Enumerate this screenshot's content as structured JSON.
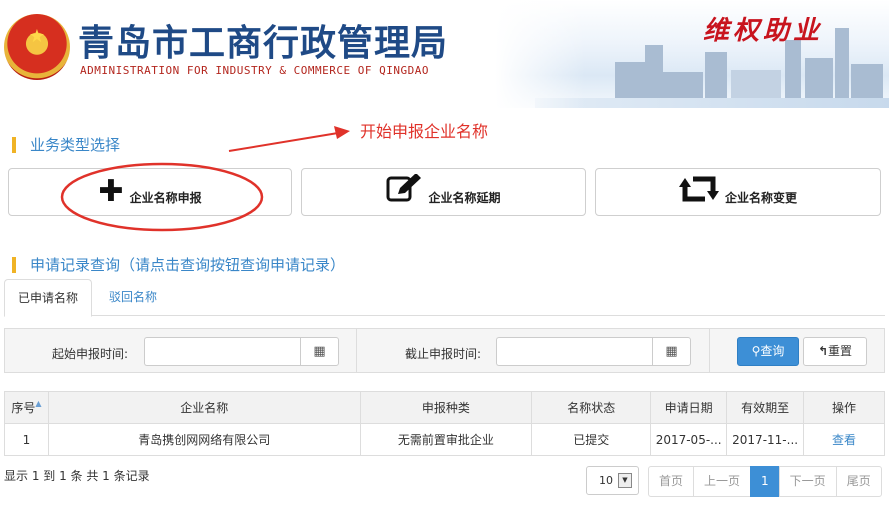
{
  "header": {
    "title_cn": "青岛市工商行政管理局",
    "title_en": "ADMINISTRATION FOR INDUSTRY & COMMERCE OF QINGDAO",
    "slogan": "维权助业"
  },
  "annotation": {
    "text": "开始申报企业名称",
    "color": "#e0322a"
  },
  "section_business": {
    "title": "业务类型选择"
  },
  "business_buttons": [
    {
      "label": "企业名称申报",
      "icon": "plus-icon"
    },
    {
      "label": "企业名称延期",
      "icon": "edit-icon"
    },
    {
      "label": "企业名称变更",
      "icon": "retweet-icon"
    }
  ],
  "section_records": {
    "title": "申请记录查询（请点击查询按钮查询申请记录）"
  },
  "tabs": [
    {
      "label": "已申请名称",
      "active": true
    },
    {
      "label": "驳回名称",
      "active": false
    }
  ],
  "filter": {
    "start_label": "起始申报时间:",
    "start_value": "",
    "end_label": "截止申报时间:",
    "end_value": "",
    "query_label": "查询",
    "reset_label": "重置"
  },
  "table": {
    "columns": [
      "序号",
      "企业名称",
      "申报种类",
      "名称状态",
      "申请日期",
      "有效期至",
      "操作"
    ],
    "rows": [
      {
        "index": "1",
        "name": "青岛携创网网络有限公司",
        "type": "无需前置审批企业",
        "status": "已提交",
        "apply_date": "2017-05-...",
        "valid_until": "2017-11-...",
        "action": "查看"
      }
    ]
  },
  "footer": {
    "summary": "显示 1 到 1 条 共 1 条记录",
    "page_size": "10",
    "pager": {
      "first": "首页",
      "prev": "上一页",
      "current": "1",
      "next": "下一页",
      "last": "尾页"
    }
  },
  "colors": {
    "accent": "#3a87c8",
    "button_primary": "#3d8fd6",
    "section_bar": "#f0b325"
  }
}
